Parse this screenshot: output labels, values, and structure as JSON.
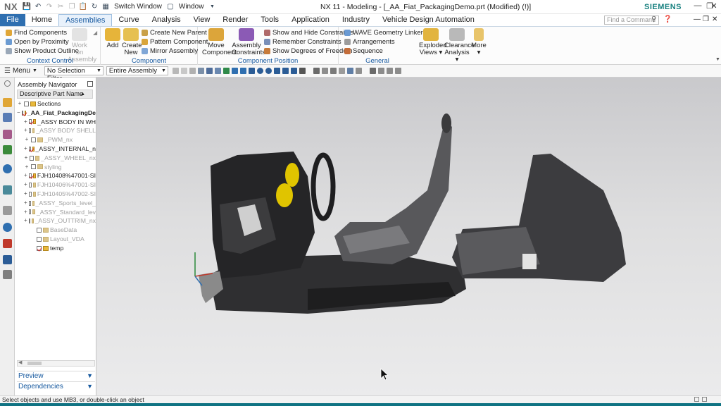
{
  "titlebar": {
    "logo": "NX",
    "switch_window": "Switch Window",
    "window_menu": "Window",
    "title": "NX 11 - Modeling - [_AA_Fiat_PackagingDemo.prt (Modified) (!)]",
    "brand": "SIEMENS"
  },
  "menubar": {
    "items": [
      "File",
      "Home",
      "Assemblies",
      "Curve",
      "Analysis",
      "View",
      "Render",
      "Tools",
      "Application",
      "Industry",
      "Vehicle Design Automation"
    ],
    "active": "Assemblies",
    "search_placeholder": "Find a Command"
  },
  "ribbon": {
    "context_control": {
      "label": "Context Control",
      "find_components": "Find Components",
      "open_by_proximity": "Open by Proximity",
      "show_product_outline": "Show Product Outline",
      "work_on_assembly": "Work on Assembly"
    },
    "component": {
      "label": "Component",
      "add": "Add",
      "create_new": "Create New",
      "create_new_parent": "Create New Parent",
      "pattern_component": "Pattern Component",
      "mirror_assembly": "Mirror Assembly"
    },
    "component_position": {
      "label": "Component Position",
      "move_component": "Move Component",
      "assembly_constraints": "Assembly Constraints",
      "show_hide_constraints": "Show and Hide Constraints",
      "remember_constraints": "Remember Constraints",
      "show_degrees_of_freedom": "Show Degrees of Freedom"
    },
    "general": {
      "label": "General",
      "wave_geometry_linker": "WAVE Geometry Linker",
      "arrangements": "Arrangements",
      "sequence": "Sequence",
      "exploded_views": "Exploded Views",
      "clearance_analysis": "Clearance Analysis",
      "more": "More"
    }
  },
  "toolbar": {
    "menu": "Menu",
    "selection_filter": "No Selection Filter",
    "scope": "Entire Assembly"
  },
  "navigator": {
    "title": "Assembly Navigator",
    "column_header": "Descriptive Part Name",
    "rows": [
      {
        "label": "Sections",
        "expand": "+",
        "checked": false,
        "dim": false,
        "bold": false,
        "folder": true
      },
      {
        "label": "_AA_Fiat_PackagingDe",
        "expand": "−",
        "checked": true,
        "dim": false,
        "bold": true,
        "folder": false
      },
      {
        "label": "_ASSY BODY IN WH",
        "expand": "+",
        "checked": true,
        "dim": false,
        "bold": false,
        "folder": false
      },
      {
        "label": "_ASSY BODY SHELL",
        "expand": "+",
        "checked": false,
        "dim": true,
        "bold": false,
        "folder": false
      },
      {
        "label": "_PWM_nx",
        "expand": "+",
        "checked": false,
        "dim": true,
        "bold": false,
        "folder": false
      },
      {
        "label": "_ASSY_INTERNAL_n",
        "expand": "+",
        "checked": true,
        "dim": false,
        "bold": false,
        "folder": false
      },
      {
        "label": "_ASSY_WHEEL_nx",
        "expand": "+",
        "checked": false,
        "dim": true,
        "bold": false,
        "folder": false
      },
      {
        "label": "styling",
        "expand": "+",
        "checked": false,
        "dim": true,
        "bold": false,
        "folder": false
      },
      {
        "label": "FJH10408%47001-SI",
        "expand": "+",
        "checked": true,
        "dim": false,
        "bold": false,
        "folder": false
      },
      {
        "label": "FJH10406%47001-SI",
        "expand": "+",
        "checked": false,
        "dim": true,
        "bold": false,
        "folder": false
      },
      {
        "label": "FJH10405%47002-SI",
        "expand": "+",
        "checked": false,
        "dim": true,
        "bold": false,
        "folder": false
      },
      {
        "label": "_ASSY_Sports_level_",
        "expand": "+",
        "checked": false,
        "dim": true,
        "bold": false,
        "folder": false
      },
      {
        "label": "_ASSY_Standard_lev",
        "expand": "+",
        "checked": false,
        "dim": true,
        "bold": false,
        "folder": false
      },
      {
        "label": "_ASSY_OUTTRIM_nx",
        "expand": "+",
        "checked": false,
        "dim": true,
        "bold": false,
        "folder": false
      },
      {
        "label": "BaseData",
        "expand": "",
        "checked": false,
        "dim": true,
        "bold": false,
        "folder": false
      },
      {
        "label": "Layout_VDA",
        "expand": "",
        "checked": false,
        "dim": true,
        "bold": false,
        "folder": false
      },
      {
        "label": "temp",
        "expand": "",
        "checked": true,
        "dim": false,
        "bold": false,
        "folder": false
      }
    ],
    "preview": "Preview",
    "dependencies": "Dependencies"
  },
  "status": {
    "message": "Select objects and use MB3, or double-click an object"
  },
  "colors": {
    "accent": "#2f6fb0",
    "ribbon_label": "#14579e",
    "brand": "#17807f",
    "bottom_strip": "#107383",
    "part_yellow": "#e0c400"
  }
}
